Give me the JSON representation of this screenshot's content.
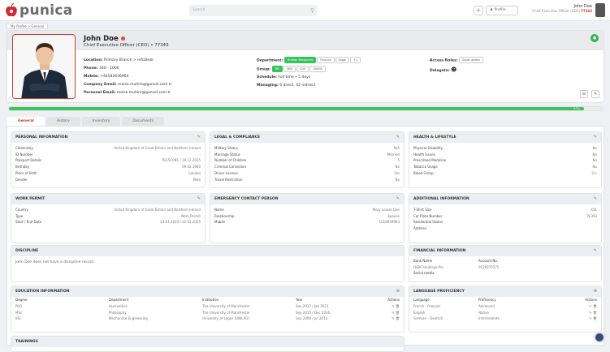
{
  "app": {
    "name": "punica"
  },
  "topbar": {
    "search_placeholder": "Search",
    "profile_label": "Profile",
    "user_name": "John Doe",
    "user_role": "Chief Executive Officer (CEO)",
    "user_id": "77343"
  },
  "breadcrumb": "My Profile > General",
  "profile": {
    "name": "John Doe",
    "title": "Chief Executive Officer (CEO) • 77343",
    "location_label": "Location:",
    "location": "Primary Branch > InfoDesk",
    "phone_label": "Phone:",
    "phone": "340 - 1000",
    "mobile_label": "Mobile:",
    "mobile": "+44582636964",
    "company_email_label": "Company Email:",
    "company_email": "moise.muhire@gunsel.com.tr",
    "personal_email_label": "Personal Email:",
    "personal_email": "moise.muhire@gunsel.com.tr",
    "department_label": "Department:",
    "department": "Human Resources",
    "department_tags": [
      "Finance",
      "Legal",
      "+1"
    ],
    "group_label": "Group:",
    "groups": [
      "HR",
      "FMS",
      "LDO",
      "OWOR"
    ],
    "schedule_label": "Schedule:",
    "schedule": "Full time • 5 days",
    "managing_label": "Managing:",
    "managing": "6 direct, 42 indirect",
    "access_label": "Access Roles:",
    "access": "Super admin",
    "delegate_label": "Delegate:"
  },
  "progress": {
    "value": 97,
    "label": "97%"
  },
  "tabs": [
    "General",
    "History",
    "Inventory",
    "Documents"
  ],
  "personal": {
    "title": "PERSONAL INFORMATION",
    "rows": [
      [
        "Citizenship",
        "United Kingdom of Great Britain and Northern Ireland"
      ],
      [
        "ID Number",
        "-"
      ],
      [
        "Passport Details",
        "P2L5C0N1 / 19.12.2025"
      ],
      [
        "Birthday",
        "09.02.1960"
      ],
      [
        "Place of Birth",
        "London"
      ],
      [
        "Gender",
        "Male"
      ]
    ]
  },
  "legal": {
    "title": "LEGAL & COMPLIANCE",
    "rows": [
      [
        "Military Status",
        "N/A"
      ],
      [
        "Marriage Status",
        "Married"
      ],
      [
        "Number of Children",
        "5"
      ],
      [
        "Criminal Conviction",
        "No"
      ],
      [
        "Driver License",
        "Yes"
      ],
      [
        "Travel Restriction",
        "No"
      ]
    ]
  },
  "health": {
    "title": "HEALTH & LIFESTYLE",
    "rows": [
      [
        "Physical Disability",
        "No"
      ],
      [
        "Health Issues",
        "No"
      ],
      [
        "Prescribed Medicine",
        "No"
      ],
      [
        "Tobacco Usage",
        "No"
      ],
      [
        "Blood Group",
        "O+"
      ]
    ]
  },
  "permit": {
    "title": "WORK PERMIT",
    "rows": [
      [
        "Country",
        "United Kingdom of Great Britain and Northern Ireland"
      ],
      [
        "Type",
        "Work Permit"
      ],
      [
        "Start / End Date",
        "23.01.2024 / 22.01.2025"
      ]
    ]
  },
  "emergency": {
    "title": "EMERGENCY CONTACT PERSON",
    "rows": [
      [
        "Name",
        "Mary Louise Doe"
      ],
      [
        "Relationship",
        "Spouse"
      ],
      [
        "Mobile",
        "1019839964"
      ]
    ]
  },
  "additional": {
    "title": "ADDITIONAL INFORMATION",
    "rows": [
      [
        "T-Shirt Size",
        "XXL"
      ],
      [
        "Car Plate Number",
        "PJ-393"
      ],
      [
        "Residential Status",
        ""
      ],
      [
        "Address",
        ""
      ]
    ]
  },
  "discipline": {
    "title": "DISCIPLINE",
    "text": "John Doe does not have a discipline record."
  },
  "financial": {
    "title": "FINANCIAL INFORMATION",
    "bank_label": "Bank Name",
    "account_label": "Account No.",
    "bank": "HSBC Holdings Plc.",
    "account": "0120075575",
    "social": "Social media"
  },
  "education": {
    "title": "EDUCATION INFORMATION",
    "headers": [
      "Degree",
      "Department",
      "Institution",
      "Year",
      "Actions"
    ],
    "rows": [
      [
        "PhD",
        "Humanities",
        "The University of Manchester",
        "Sep 2017 / Jan 2021"
      ],
      [
        "MSc",
        "Philosophy",
        "The University of Manchester",
        "Sep 2015 / Dec 2016"
      ],
      [
        "BSc",
        "Mechanical Engineering",
        "University of Lagos (UNILAG)",
        "Sep 2009 / Jul 2014"
      ]
    ]
  },
  "language": {
    "title": "LANGUAGE PROFICIENCY",
    "headers": [
      "Language",
      "Proficiency",
      "Actions"
    ],
    "rows": [
      [
        "French - français",
        "Advanced"
      ],
      [
        "English",
        "Native"
      ],
      [
        "German - Deutsch",
        "Intermediate"
      ]
    ]
  },
  "trainings": {
    "title": "TRAININGS"
  },
  "colors": {
    "accent": "#c0392b",
    "green": "#35c35a"
  }
}
